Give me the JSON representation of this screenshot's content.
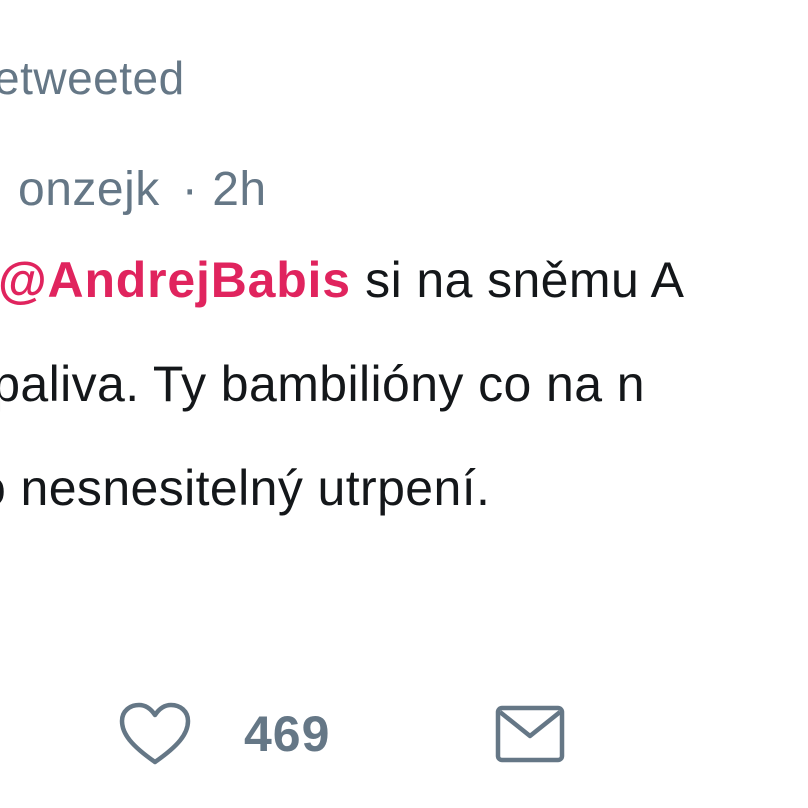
{
  "retweet_context": {
    "text": "etweeted"
  },
  "tweet": {
    "author_handle": "onzejk",
    "separator": "·",
    "timestamp": "2h",
    "lines": [
      {
        "mention": "@AndrejBabis",
        "text": " si na sněmu A"
      },
      {
        "text": "opaliva. Ty bambilióny co na n"
      },
      {
        "text": "o nesnesitelný utrpení."
      }
    ]
  },
  "actions": {
    "like_count": "469",
    "like_icon": "heart-icon",
    "message_icon": "envelope-icon"
  },
  "colors": {
    "mention": "#e0245e",
    "secondary_text": "#657786",
    "primary_text": "#14171a"
  }
}
